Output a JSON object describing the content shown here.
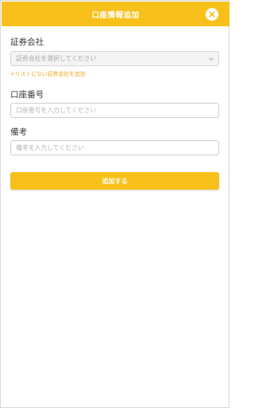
{
  "header": {
    "title": "口座情報追加",
    "close_icon": "close-circle-icon"
  },
  "form": {
    "company": {
      "label": "証券会社",
      "placeholder": "証券会社を選択してください",
      "add_link": "+リストにない証券会社を追加"
    },
    "account_number": {
      "label": "口座番号",
      "placeholder": "口座番号を入力してください",
      "value": ""
    },
    "note": {
      "label": "備考",
      "placeholder": "備考を入力してください",
      "value": ""
    },
    "submit_label": "追加する"
  },
  "colors": {
    "accent": "#f8c01a",
    "link": "#f0a81c"
  }
}
